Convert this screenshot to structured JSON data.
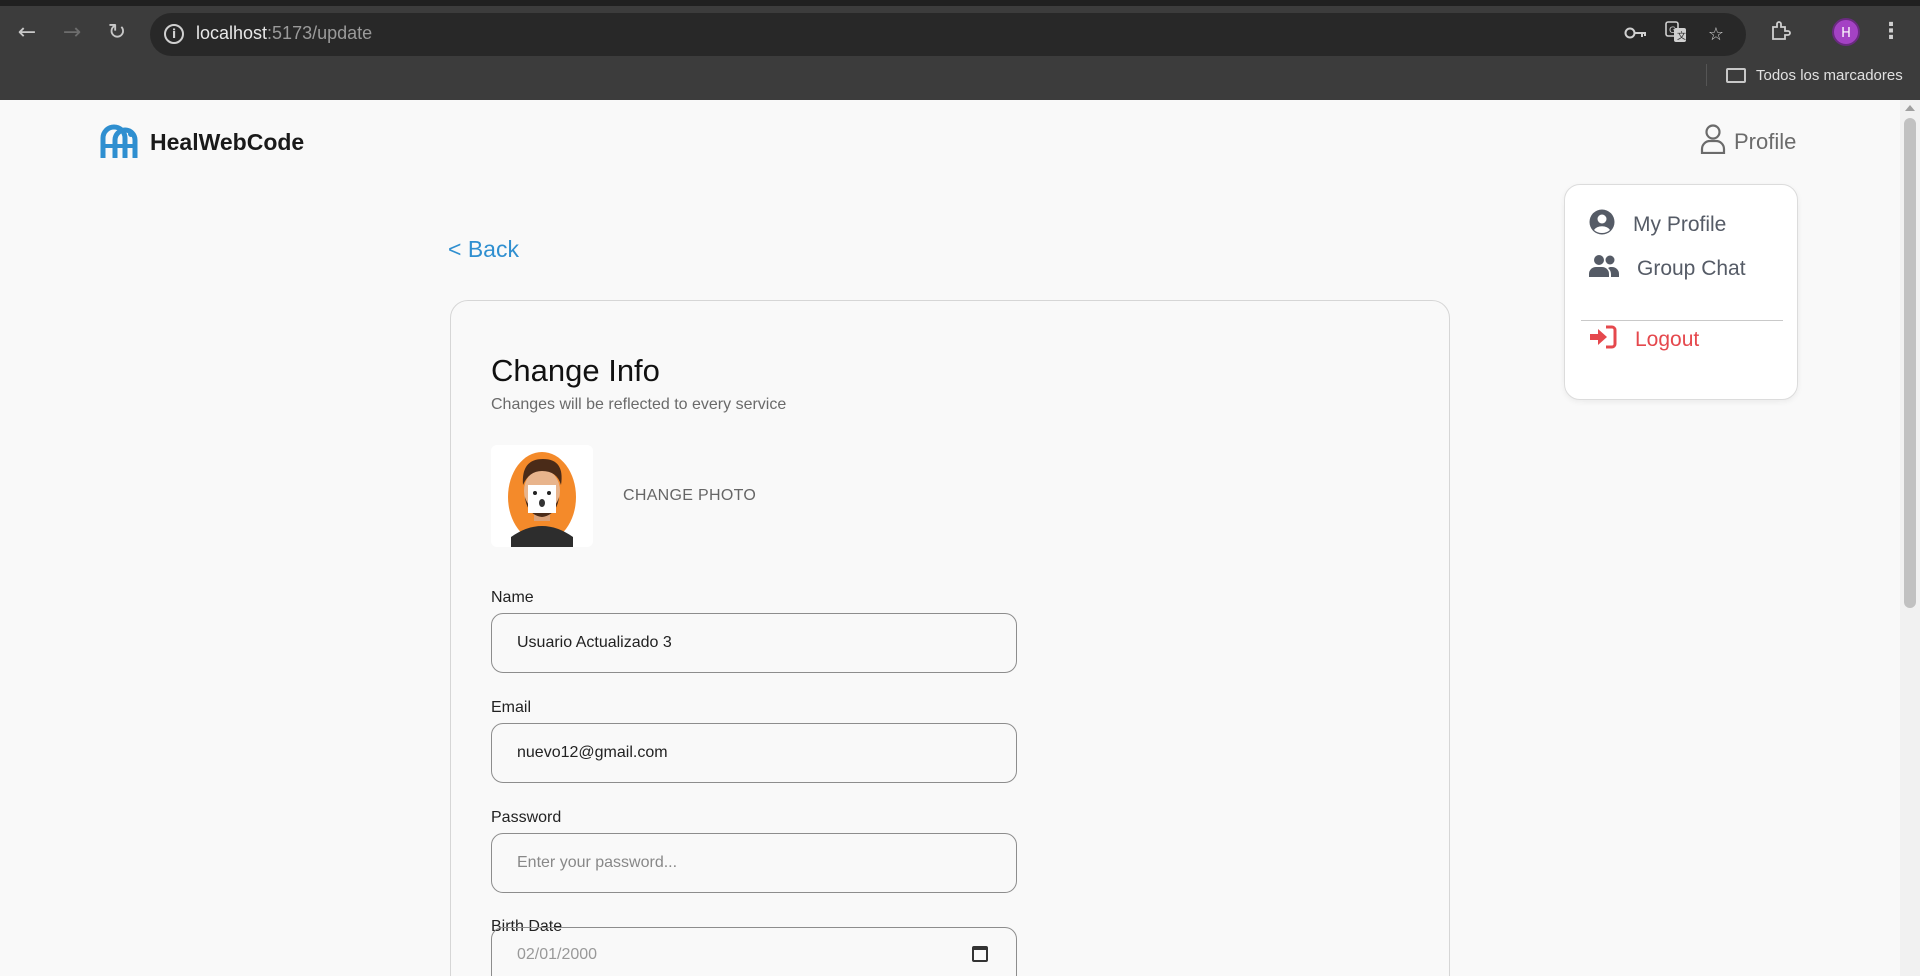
{
  "browser": {
    "url_host": "localhost",
    "url_path": ":5173/update",
    "bookmark_folder": "Todos los marcadores",
    "profile_initial": "H"
  },
  "header": {
    "brand": "HealWebCode",
    "profile_label": "Profile"
  },
  "dropdown": {
    "items": [
      {
        "label": "My Profile",
        "icon": "user-circle-icon"
      },
      {
        "label": "Group Chat",
        "icon": "users-icon"
      }
    ],
    "logout_label": "Logout"
  },
  "nav": {
    "back_label": "< Back"
  },
  "form": {
    "title": "Change Info",
    "subtitle": "Changes will be reflected to every service",
    "change_photo_label": "CHANGE PHOTO",
    "fields": {
      "name": {
        "label": "Name",
        "value": "Usuario Actualizado 3"
      },
      "email": {
        "label": "Email",
        "value": "nuevo12@gmail.com"
      },
      "password": {
        "label": "Password",
        "placeholder": "Enter your password..."
      },
      "birth_date": {
        "label": "Birth Date",
        "value": "02/01/2000"
      }
    }
  },
  "colors": {
    "accent": "#2f8fd0",
    "logout": "#e5484d",
    "brand_icon": "#2f8fd0"
  }
}
